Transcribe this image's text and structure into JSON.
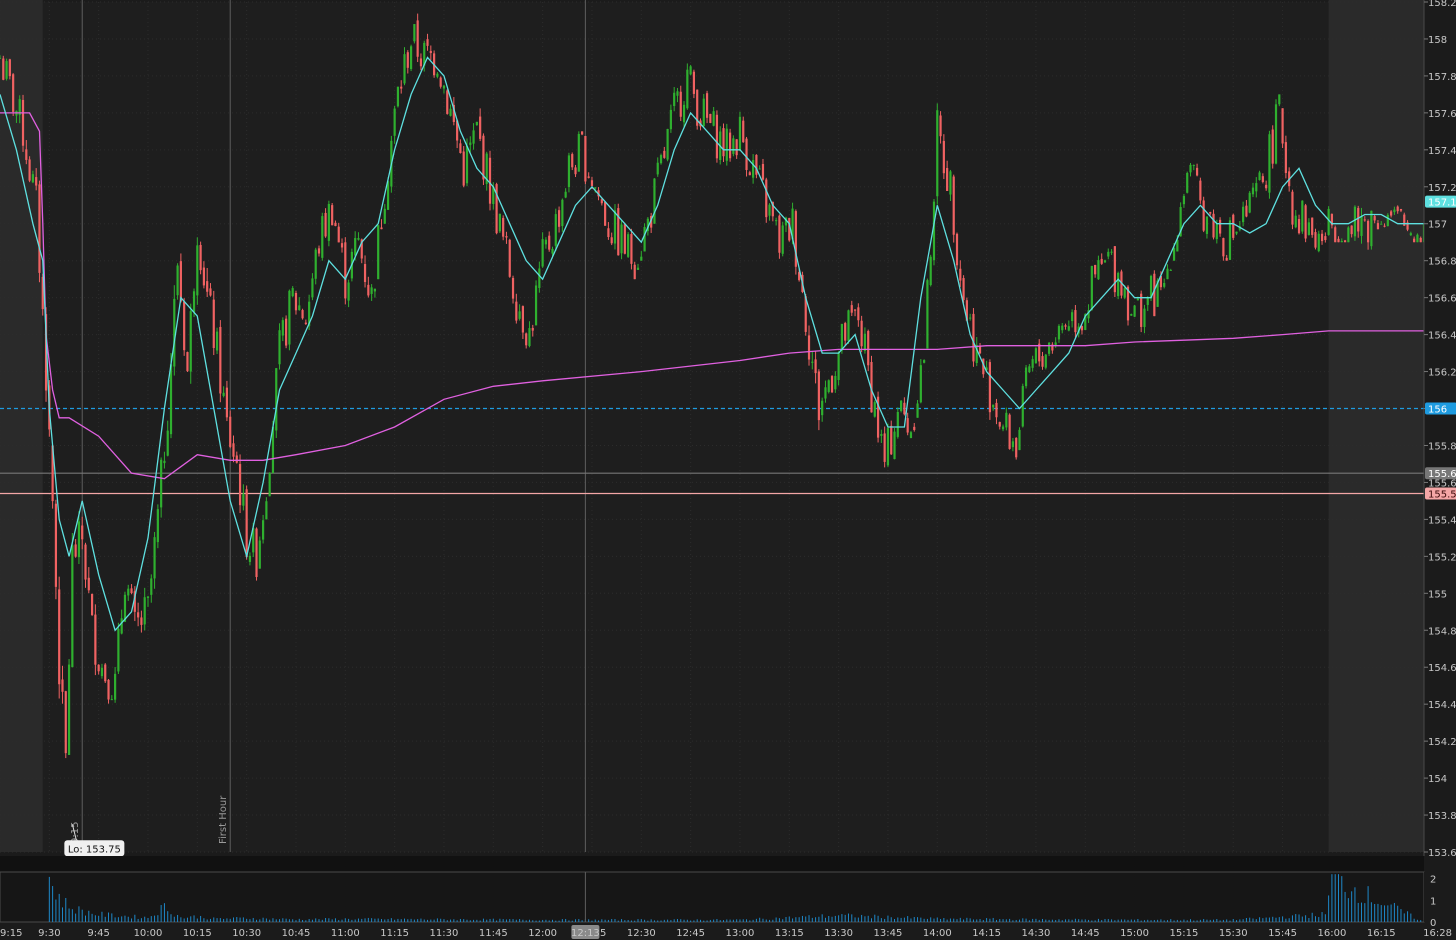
{
  "chart_data": {
    "type": "candlestick",
    "title": "",
    "colors": {
      "background": "#1b1b1b",
      "session_background": "#1e1e1e",
      "extended_hours_shade": "#2a2a2a",
      "up_candle": "#2fb02f",
      "down_candle": "#f06262",
      "ema_line": "#5ee0e0",
      "vwap_line": "#e060e0",
      "alert_line": "#1e9be0",
      "support_line": "#f4a6a6",
      "volume": "#1e88c8"
    },
    "y_axis": {
      "min": 153.6,
      "max": 158.2,
      "ticks": [
        "158.2",
        "158",
        "157.8",
        "157.6",
        "157.4",
        "157.2",
        "157",
        "156.8",
        "156.6",
        "156.4",
        "156.2",
        "156",
        "155.8",
        "155.6",
        "155.4",
        "155.2",
        "155",
        "154.8",
        "154.6",
        "154.4",
        "154.2",
        "154",
        "153.8",
        "153.6"
      ]
    },
    "x_axis": {
      "start": "9:15",
      "end": "16:28",
      "tick_labels": [
        "9:15",
        "9:30",
        "9:45",
        "10:00",
        "10:15",
        "10:30",
        "10:45",
        "11:00",
        "11:15",
        "11:30",
        "11:45",
        "12:00",
        "12:15",
        "12:30",
        "12:45",
        "13:00",
        "13:15",
        "13:30",
        "13:45",
        "14:00",
        "14:15",
        "14:30",
        "14:45",
        "15:00",
        "15:15",
        "15:30",
        "15:45",
        "16:00",
        "16:15",
        "16:28"
      ],
      "crosshair_label": "12:13"
    },
    "extended_hours": [
      {
        "from": "9:15",
        "to": "9:28"
      },
      {
        "from": "15:59",
        "to": "16:28"
      }
    ],
    "price_badges": [
      {
        "label": "157.1",
        "value": 157.12,
        "style": "ema"
      },
      {
        "label": "156",
        "value": 156.0,
        "style": "alert"
      },
      {
        "label": "155.6",
        "value": 155.65,
        "style": "grey"
      },
      {
        "label": "155.5",
        "value": 155.54,
        "style": "support"
      }
    ],
    "horizontal_lines": [
      {
        "value": 156.0,
        "style": "alert"
      },
      {
        "value": 155.65,
        "style": "grey"
      },
      {
        "value": 155.54,
        "style": "support"
      }
    ],
    "vertical_markers": [
      {
        "time": "9:40",
        "label": "9:15"
      },
      {
        "time": "10:25",
        "label": "First Hour"
      },
      {
        "time": "12:13",
        "label": ""
      }
    ],
    "low_label": {
      "text": "Lo: 153.75",
      "time": "9:37",
      "value": 153.75
    },
    "price_series": {
      "times": [
        "9:15",
        "9:22",
        "9:26",
        "9:29",
        "9:31",
        "9:33",
        "9:35",
        "9:37",
        "9:40",
        "9:43",
        "9:46",
        "9:50",
        "9:53",
        "9:56",
        "10:00",
        "10:03",
        "10:06",
        "10:09",
        "10:12",
        "10:15",
        "10:18",
        "10:21",
        "10:24",
        "10:27",
        "10:30",
        "10:33",
        "10:36",
        "10:40",
        "10:44",
        "10:48",
        "10:52",
        "10:56",
        "11:00",
        "11:04",
        "11:08",
        "11:12",
        "11:16",
        "11:20",
        "11:24",
        "11:28",
        "11:32",
        "11:36",
        "11:40",
        "11:44",
        "11:48",
        "11:52",
        "11:56",
        "12:00",
        "12:04",
        "12:08",
        "12:12",
        "12:16",
        "12:20",
        "12:24",
        "12:28",
        "12:32",
        "12:36",
        "12:40",
        "12:44",
        "12:48",
        "12:52",
        "12:56",
        "13:00",
        "13:04",
        "13:08",
        "13:12",
        "13:16",
        "13:20",
        "13:24",
        "13:28",
        "13:32",
        "13:36",
        "13:40",
        "13:44",
        "13:48",
        "13:52",
        "13:56",
        "14:00",
        "14:04",
        "14:08",
        "14:12",
        "14:16",
        "14:20",
        "14:24",
        "14:28",
        "14:32",
        "14:36",
        "14:40",
        "14:44",
        "14:48",
        "14:52",
        "14:56",
        "15:00",
        "15:04",
        "15:08",
        "15:12",
        "15:16",
        "15:20",
        "15:24",
        "15:28",
        "15:32",
        "15:36",
        "15:40",
        "15:44",
        "15:48",
        "15:52",
        "15:56",
        "16:00",
        "16:05",
        "16:10",
        "16:15",
        "16:20",
        "16:25",
        "16:28"
      ],
      "close": [
        157.9,
        157.5,
        157.1,
        156.2,
        155.5,
        154.6,
        154.1,
        155.2,
        155.3,
        154.8,
        154.6,
        154.5,
        155.1,
        154.8,
        154.9,
        155.4,
        156.0,
        156.8,
        156.2,
        157.0,
        156.6,
        156.3,
        155.9,
        155.7,
        155.3,
        155.2,
        155.6,
        156.3,
        156.6,
        156.5,
        156.9,
        157.1,
        156.7,
        156.9,
        156.6,
        157.2,
        157.7,
        158.0,
        157.9,
        157.9,
        157.6,
        157.3,
        157.5,
        157.2,
        156.9,
        156.6,
        156.4,
        156.8,
        157.0,
        157.3,
        157.4,
        157.2,
        157.0,
        156.9,
        156.8,
        157.0,
        157.3,
        157.6,
        157.8,
        157.6,
        157.5,
        157.4,
        157.5,
        157.3,
        157.1,
        156.9,
        157.0,
        156.5,
        156.0,
        156.2,
        156.4,
        156.5,
        156.1,
        155.7,
        156.0,
        155.9,
        156.3,
        157.5,
        157.2,
        156.6,
        156.3,
        156.1,
        155.9,
        155.8,
        156.2,
        156.3,
        156.4,
        156.5,
        156.5,
        156.7,
        156.8,
        156.7,
        156.5,
        156.6,
        156.6,
        156.9,
        157.3,
        157.1,
        157.0,
        156.9,
        157.0,
        157.1,
        157.3,
        157.6,
        157.1,
        157.0,
        156.9,
        157.0,
        156.95,
        157.0,
        157.05,
        157.0,
        156.95,
        157.0
      ],
      "high": [
        158.0,
        157.8,
        157.4,
        156.9,
        155.8,
        155.5,
        155.2,
        155.7,
        155.8,
        155.6,
        155.3,
        155.1,
        155.6,
        155.4,
        155.4,
        156.4,
        157.4,
        157.2,
        157.3,
        157.3,
        157.3,
        156.7,
        156.3,
        156.0,
        155.9,
        155.6,
        156.1,
        156.7,
        156.9,
        157.0,
        157.1,
        157.3,
        157.0,
        157.3,
        157.1,
        157.7,
        158.1,
        158.2,
        158.2,
        158.1,
        158.0,
        157.7,
        157.8,
        157.6,
        157.3,
        157.1,
        156.9,
        157.2,
        157.4,
        157.5,
        157.5,
        157.4,
        157.3,
        157.2,
        157.1,
        157.4,
        157.6,
        157.9,
        158.0,
        157.8,
        157.7,
        157.7,
        157.7,
        157.6,
        157.4,
        157.2,
        157.3,
        157.0,
        156.6,
        156.5,
        156.7,
        156.7,
        156.4,
        156.1,
        156.2,
        156.3,
        157.0,
        157.8,
        157.5,
        157.0,
        156.7,
        156.5,
        156.3,
        156.2,
        156.5,
        156.6,
        156.7,
        156.8,
        156.9,
        157.0,
        157.0,
        156.9,
        156.8,
        156.9,
        157.0,
        157.3,
        157.4,
        157.3,
        157.2,
        157.2,
        157.2,
        157.4,
        157.6,
        157.7,
        157.4,
        157.2,
        157.1,
        157.1,
        157.1,
        157.1,
        157.1,
        157.1,
        157.0,
        157.0
      ],
      "low": [
        157.7,
        157.0,
        156.5,
        155.3,
        154.2,
        153.9,
        153.75,
        154.5,
        154.8,
        154.4,
        154.3,
        154.3,
        154.7,
        154.5,
        154.6,
        155.2,
        155.5,
        156.0,
        155.9,
        156.3,
        156.0,
        155.7,
        155.3,
        155.1,
        154.9,
        155.0,
        155.4,
        155.9,
        156.2,
        156.2,
        156.6,
        156.7,
        156.5,
        156.5,
        156.4,
        157.0,
        157.3,
        157.7,
        157.6,
        157.6,
        157.3,
        157.0,
        157.1,
        156.9,
        156.6,
        156.4,
        156.3,
        156.6,
        156.8,
        157.0,
        157.1,
        157.0,
        156.8,
        156.7,
        156.7,
        156.9,
        157.1,
        157.4,
        157.5,
        157.4,
        157.3,
        157.2,
        157.2,
        157.0,
        156.9,
        156.7,
        156.6,
        155.9,
        155.7,
        155.9,
        156.2,
        156.1,
        155.7,
        155.5,
        155.8,
        155.8,
        156.1,
        157.0,
        156.8,
        156.2,
        156.0,
        155.8,
        155.7,
        155.7,
        156.0,
        156.1,
        156.3,
        156.3,
        156.4,
        156.5,
        156.6,
        156.4,
        156.3,
        156.4,
        156.6,
        156.8,
        157.0,
        156.9,
        156.8,
        156.8,
        156.8,
        156.9,
        157.1,
        157.2,
        156.9,
        156.9,
        156.8,
        156.9,
        156.9,
        156.2,
        157.0,
        156.9,
        156.9,
        156.9
      ]
    },
    "ema_series": {
      "times": [
        "9:15",
        "9:20",
        "9:25",
        "9:28",
        "9:30",
        "9:33",
        "9:36",
        "9:40",
        "9:45",
        "9:50",
        "9:55",
        "10:00",
        "10:05",
        "10:10",
        "10:15",
        "10:20",
        "10:25",
        "10:30",
        "10:35",
        "10:40",
        "10:45",
        "10:50",
        "10:55",
        "11:00",
        "11:05",
        "11:10",
        "11:15",
        "11:20",
        "11:25",
        "11:30",
        "11:35",
        "11:40",
        "11:45",
        "11:50",
        "11:55",
        "12:00",
        "12:05",
        "12:10",
        "12:15",
        "12:20",
        "12:25",
        "12:30",
        "12:35",
        "12:40",
        "12:45",
        "12:50",
        "12:55",
        "13:00",
        "13:05",
        "13:10",
        "13:15",
        "13:20",
        "13:25",
        "13:30",
        "13:35",
        "13:40",
        "13:45",
        "13:50",
        "13:55",
        "14:00",
        "14:05",
        "14:10",
        "14:15",
        "14:20",
        "14:25",
        "14:30",
        "14:35",
        "14:40",
        "14:45",
        "14:50",
        "14:55",
        "15:00",
        "15:05",
        "15:10",
        "15:15",
        "15:20",
        "15:25",
        "15:30",
        "15:35",
        "15:40",
        "15:45",
        "15:50",
        "15:55",
        "16:00",
        "16:05",
        "16:10",
        "16:15",
        "16:20",
        "16:28"
      ],
      "values": [
        157.7,
        157.4,
        157.0,
        156.8,
        156.0,
        155.4,
        155.2,
        155.5,
        155.1,
        154.8,
        154.9,
        155.3,
        156.0,
        156.6,
        156.5,
        156.0,
        155.5,
        155.2,
        155.6,
        156.1,
        156.3,
        156.5,
        156.8,
        156.7,
        156.9,
        157.0,
        157.4,
        157.7,
        157.9,
        157.8,
        157.5,
        157.3,
        157.2,
        157.0,
        156.8,
        156.7,
        156.9,
        157.1,
        157.2,
        157.1,
        157.0,
        156.9,
        157.1,
        157.4,
        157.6,
        157.5,
        157.4,
        157.4,
        157.3,
        157.1,
        157.0,
        156.6,
        156.3,
        156.3,
        156.4,
        156.1,
        155.9,
        155.9,
        156.6,
        157.1,
        156.8,
        156.4,
        156.2,
        156.1,
        156.0,
        156.1,
        156.2,
        156.3,
        156.5,
        156.6,
        156.7,
        156.6,
        156.6,
        156.8,
        157.0,
        157.1,
        157.0,
        157.0,
        156.95,
        157.0,
        157.2,
        157.3,
        157.1,
        157.0,
        157.0,
        157.05,
        157.05,
        157.0,
        157.0
      ]
    },
    "vwap_series": {
      "times": [
        "9:15",
        "9:24",
        "9:27",
        "9:28",
        "9:29",
        "9:31",
        "9:33",
        "9:36",
        "9:45",
        "9:55",
        "10:05",
        "10:15",
        "10:25",
        "10:35",
        "10:45",
        "11:00",
        "11:15",
        "11:30",
        "11:45",
        "12:00",
        "12:30",
        "13:00",
        "13:15",
        "13:30",
        "14:00",
        "14:15",
        "14:45",
        "15:00",
        "15:15",
        "15:30",
        "15:45",
        "15:59",
        "16:28"
      ],
      "values": [
        157.6,
        157.6,
        157.5,
        157.0,
        156.4,
        156.1,
        155.95,
        155.95,
        155.85,
        155.65,
        155.62,
        155.75,
        155.72,
        155.72,
        155.75,
        155.8,
        155.9,
        156.05,
        156.12,
        156.15,
        156.2,
        156.26,
        156.3,
        156.32,
        156.32,
        156.34,
        156.34,
        156.36,
        156.37,
        156.38,
        156.4,
        156.42,
        156.42
      ]
    },
    "volume_series": {
      "y_ticks": [
        "2",
        "1",
        "0"
      ],
      "times": [
        "9:15",
        "9:29",
        "9:30",
        "9:33",
        "9:36",
        "9:40",
        "9:45",
        "9:50",
        "9:55",
        "10:00",
        "10:05",
        "10:10",
        "10:15",
        "10:20",
        "10:30",
        "10:45",
        "11:00",
        "11:30",
        "12:00",
        "12:30",
        "13:00",
        "13:30",
        "14:00",
        "14:30",
        "15:00",
        "15:30",
        "15:58",
        "16:00",
        "16:28"
      ],
      "values": [
        0,
        0,
        2.0,
        1.1,
        0.7,
        0.5,
        0.35,
        0.3,
        0.25,
        0.2,
        0.7,
        0.2,
        0.25,
        0.15,
        0.18,
        0.12,
        0.14,
        0.12,
        0.1,
        0.1,
        0.1,
        0.3,
        0.15,
        0.12,
        0.1,
        0.1,
        0.35,
        2.0,
        0
      ]
    }
  }
}
